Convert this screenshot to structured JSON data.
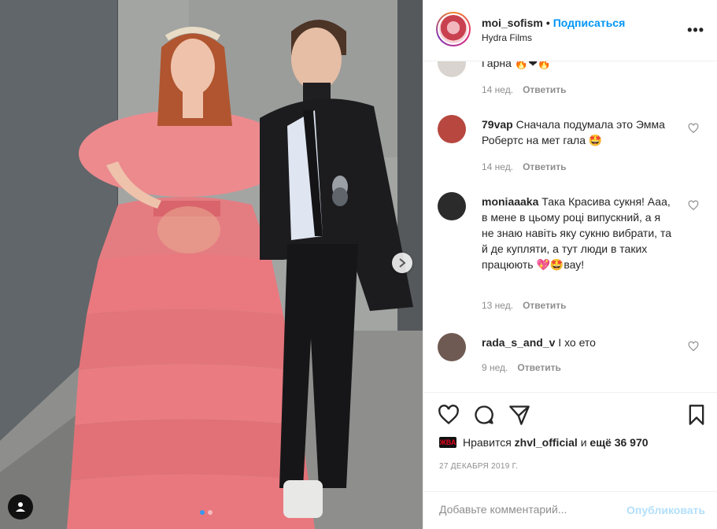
{
  "header": {
    "username": "moi_sofism",
    "separator": "•",
    "follow_label": "Подписаться",
    "location": "Hydra Films",
    "more_label": "•••"
  },
  "comments": [
    {
      "username": "",
      "text": "Гарна 🔥❤🔥",
      "age": "14 нед.",
      "reply": "Ответить",
      "avatar_color": "#d9d4cf"
    },
    {
      "username": "79vap",
      "text": "Сначала подумала это Эмма Робертс на мет гала 🤩",
      "age": "14 нед.",
      "reply": "Ответить",
      "avatar_color": "#b7473f"
    },
    {
      "username": "moniaaaka",
      "text": "Така Красива сукня! Ааа, в мене в цьому році випускний, а я не знаю навіть яку сукню вибрати, та й де купляти, а тут люди в таких працюють 💖🤩вау!",
      "age": "13 нед.",
      "reply": "Ответить",
      "avatar_color": "#2b2b2b"
    },
    {
      "username": "rada_s_and_v",
      "text": "I хо ето",
      "age": "9 нед.",
      "reply": "Ответить",
      "avatar_color": "#6e5a52"
    }
  ],
  "actions": {
    "like_icon": "heart-outline-icon",
    "comment_icon": "speech-bubble-icon",
    "share_icon": "paper-plane-icon",
    "save_icon": "bookmark-icon"
  },
  "likes": {
    "mini_avatar_text": "ЖВА",
    "prefix": "Нравится",
    "user": "zhvl_official",
    "middle": "и",
    "others": "ещё 36 970"
  },
  "date": "27 ДЕКАБРЯ 2019 Г.",
  "add_comment": {
    "placeholder": "Добавьте комментарий...",
    "publish_label": "Опубликовать"
  },
  "colors": {
    "accent": "#0095f6",
    "publish_disabled": "#b2dffc",
    "dress": "#e8737a",
    "carousel_active_dot": "#3897f0"
  }
}
